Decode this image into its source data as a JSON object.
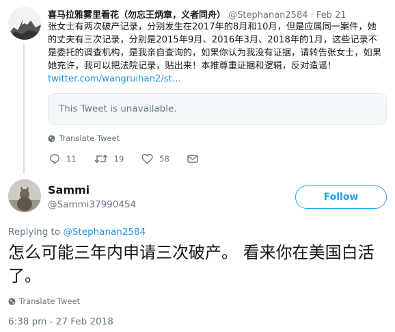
{
  "parent_tweet": {
    "display_name": "喜马拉雅雾里看花（勿忘王炳章，义者同舟）",
    "handle": "@Stephanan2584",
    "separator": "·",
    "date": "Feb 21",
    "text": "张女士有两次破产记录，分别发生在2017年的8月和10月，但是应属同一案件，她的丈夫有三次记录，分别是2015年9月、2016年3月、2018年的1月，这些记录不是委托的调查机构，是我亲自查询的，如果你认为我没有证据，请转告张女士，如果她充许，我可以把法院记录，贴出来！本推尊重证据和逻辑，反对造谣！",
    "link": "twitter.com/wangruihan2/st…",
    "quoted_unavailable": "This Tweet is unavailable.",
    "translate_label": "Translate Tweet",
    "actions": {
      "reply_count": "11",
      "retweet_count": "19",
      "like_count": "58"
    }
  },
  "main_tweet": {
    "display_name": "Sammi",
    "handle": "@Sammi37990454",
    "follow_label": "Follow",
    "replying_prefix": "Replying to",
    "replying_to": "@Stephanan2584",
    "text": "怎么可能三年内申请三次破产。 看来你在美国白活了。",
    "translate_label": "Translate Tweet",
    "timestamp": "6:38 pm - 27 Feb 2018"
  },
  "colors": {
    "accent": "#1da1f2",
    "link": "#1b95e0",
    "muted": "#657786",
    "thread_line": "#cce3f5"
  },
  "icons": [
    "globe-icon",
    "reply-icon",
    "retweet-icon",
    "like-icon",
    "message-icon"
  ]
}
